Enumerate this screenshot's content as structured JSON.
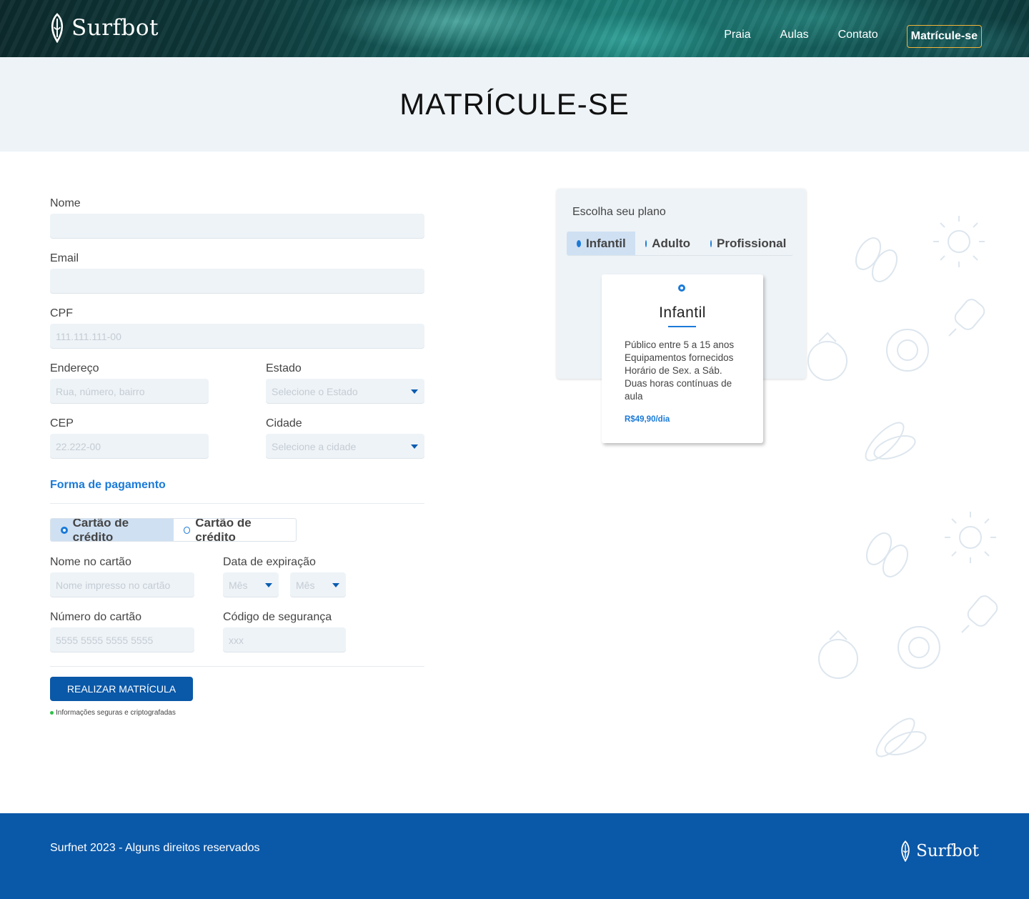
{
  "brand": {
    "name": "Surfbot",
    "logo_icon": "surfboard-icon"
  },
  "nav": {
    "items": [
      "Praia",
      "Aulas",
      "Contato"
    ],
    "cta": "Matrícule-se"
  },
  "page_title": "MATRÍCULE-SE",
  "form": {
    "nome": {
      "label": "Nome",
      "placeholder": ""
    },
    "email": {
      "label": "Email",
      "placeholder": ""
    },
    "cpf": {
      "label": "CPF",
      "placeholder": "111.111.111-00"
    },
    "endereco": {
      "label": "Endereço",
      "placeholder": "Rua, número, bairro"
    },
    "estado": {
      "label": "Estado",
      "placeholder": "Selecione o Estado"
    },
    "cep": {
      "label": "CEP",
      "placeholder": "22.222-00"
    },
    "cidade": {
      "label": "Cidade",
      "placeholder": "Selecione a cidade"
    }
  },
  "payment": {
    "section_title": "Forma de pagamento",
    "options": [
      "Cartão de crédito",
      "Cartão de crédito"
    ],
    "selected_index": 0,
    "card_name": {
      "label": "Nome no cartão",
      "placeholder": "Nome impresso no cartão"
    },
    "expiry": {
      "label": "Data de expiração",
      "month_placeholder": "Mês",
      "year_placeholder": "Mês"
    },
    "card_number": {
      "label": "Número do cartão",
      "placeholder": "5555 5555 5555 5555"
    },
    "cvv": {
      "label": "Código de segurança",
      "placeholder": "xxx"
    }
  },
  "submit_label": "REALIZAR MATRÍCULA",
  "secure_note": "Informações seguras e criptografadas",
  "plans": {
    "title": "Escolha seu plano",
    "tabs": [
      "Infantil",
      "Adulto",
      "Profissional"
    ],
    "selected_index": 0,
    "card": {
      "name": "Infantil",
      "description": [
        "Público entre 5 a 15 anos",
        "Equipamentos fornecidos",
        "Horário de Sex. a Sáb.",
        "Duas horas contínuas de aula"
      ],
      "price": "R$49,90/dia"
    }
  },
  "footer": {
    "copyright": "Surfnet 2023 -  Alguns direitos reservados",
    "brand": "Surfbot"
  },
  "colors": {
    "primary": "#0a58a8",
    "accent": "#1a7ad8",
    "cta_border": "#f2b53a",
    "field_bg": "#eef3f7"
  }
}
